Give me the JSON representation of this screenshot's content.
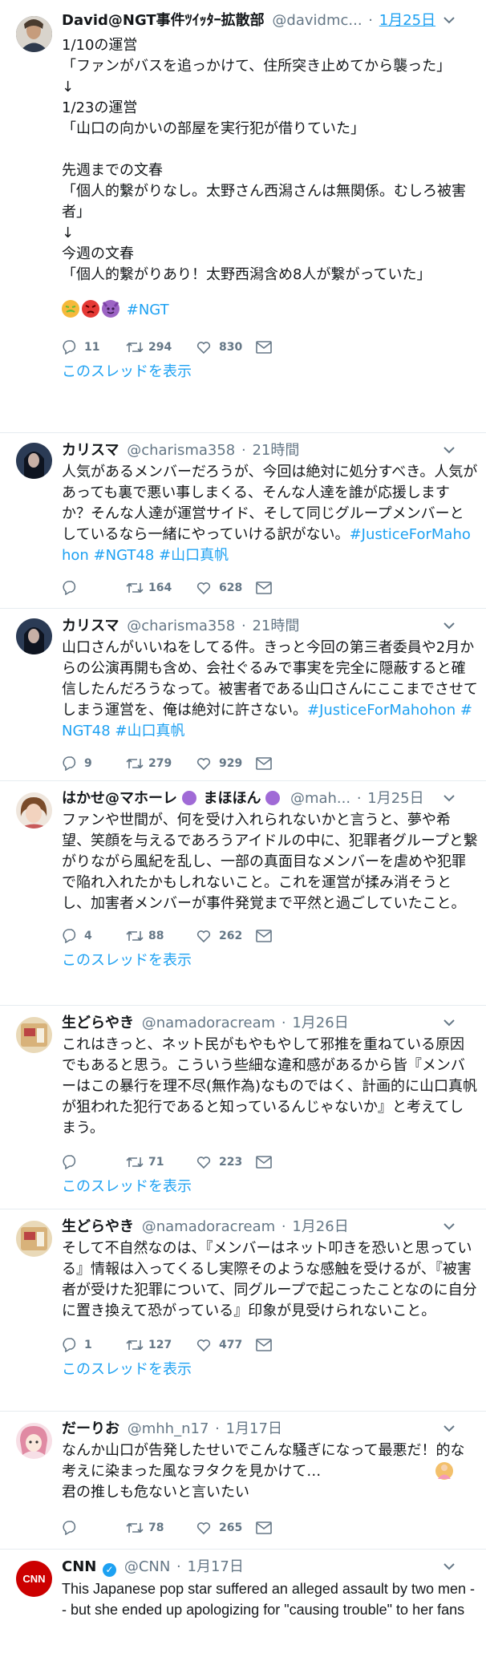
{
  "tweets": [
    {
      "name": "David@NGT事件ﾂｲｯﾀｰ拡散部",
      "handle": "@davidmc...",
      "time": "1月25日",
      "body": "1/10の運営\n「ファンがバスを追っかけて、住所突き止めてから襲った」\n↓\n1/23の運営\n「山口の向かいの部屋を実行犯が借りていた」\n\n先週までの文春\n「個人的繋がりなし。太野さん西潟さんは無関係。むしろ被害者」\n↓\n今週の文春\n「個人的繋がりあり！太野西潟含め8人が繋がっていた」",
      "hashtag": "#NGT",
      "reply_count": "11",
      "retweet_count": "294",
      "like_count": "830",
      "thread_link": "このスレッドを表示"
    },
    {
      "name": "カリスマ",
      "handle": "@charisma358",
      "time": "21時間",
      "body": "人気があるメンバーだろうが、今回は絶対に処分すべき。人気があっても裏で悪い事しまくる、そんな人達を誰が応援しますか？そんな人達が運営サイド、そして同じグループメンバーとしているなら一緒にやっていける訳がない。",
      "hashtags": "#JusticeForMahohon #NGT48 #山口真帆",
      "reply_count": "",
      "retweet_count": "164",
      "like_count": "628"
    },
    {
      "name": "カリスマ",
      "handle": "@charisma358",
      "time": "21時間",
      "body": "山口さんがいいねをしてる件。きっと今回の第三者委員や2月からの公演再開も含め、会社ぐるみで事実を完全に隠蔽すると確信したんだろうなって。被害者である山口さんにここまでさせてしまう運営を、俺は絶対に許さない。",
      "hashtags": "#JusticeForMahohon #NGT48 #山口真帆",
      "reply_count": "9",
      "retweet_count": "279",
      "like_count": "929"
    },
    {
      "name": "はかせ@マホーレ",
      "name2": "まほほん",
      "handle": "@mah...",
      "time": "1月25日",
      "body": "ファンや世間が、何を受け入れられないかと言うと、夢や希望、笑顔を与えるであろうアイドルの中に、犯罪者グループと繋がりながら風紀を乱し、一部の真面目なメンバーを虐めや犯罪で陥れ入れたかもしれないこと。これを運営が揉み消そうとし、加害者メンバーが事件発覚まで平然と過ごしていたこと。",
      "reply_count": "4",
      "retweet_count": "88",
      "like_count": "262",
      "thread_link": "このスレッドを表示"
    },
    {
      "name": "生どらやき",
      "handle": "@namadoracream",
      "time": "1月26日",
      "body": "これはきっと、ネット民がもやもやして邪推を重ねている原因でもあると思う。こういう些細な違和感があるから皆『メンバーはこの暴行を理不尽(無作為)なものではく、計画的に山口真帆が狙われた犯行であると知っているんじゃないか』と考えてしまう。",
      "reply_count": "",
      "retweet_count": "71",
      "like_count": "223",
      "thread_link": "このスレッドを表示"
    },
    {
      "name": "生どらやき",
      "handle": "@namadoracream",
      "time": "1月26日",
      "body": "そして不自然なのは、『メンバーはネット叩きを恐いと思っている』情報は入ってくるし実際そのような感触を受けるが、『被害者が受けた犯罪について、同グループで起こったことなのに自分に置き換えて恐がっている』印象が見受けられないこと。",
      "reply_count": "1",
      "retweet_count": "127",
      "like_count": "477",
      "thread_link": "このスレッドを表示"
    },
    {
      "name": "だーりお",
      "handle": "@mhh_n17",
      "time": "1月17日",
      "body": "なんか山口が告発したせいでこんな騒ぎになって最悪だ！的な考えに染まった風なヲタクを見かけて…\n君の推しも危ないと言いたい",
      "reply_count": "",
      "retweet_count": "78",
      "like_count": "265"
    },
    {
      "name": "CNN",
      "handle": "@CNN",
      "time": "1月17日",
      "avatar_text": "CNN",
      "body": "This Japanese pop star suffered an alleged assault by two men -- but she ended up apologizing for \"causing trouble\" to her fans"
    }
  ],
  "colors": {
    "link": "#1da1f2",
    "muted": "#657786",
    "text": "#14171a",
    "divider": "#e6ecf0",
    "cnn_red": "#cc0000"
  },
  "icons": [
    "reply-icon",
    "retweet-icon",
    "like-icon",
    "message-icon",
    "chevron-down-icon",
    "verified-icon"
  ]
}
